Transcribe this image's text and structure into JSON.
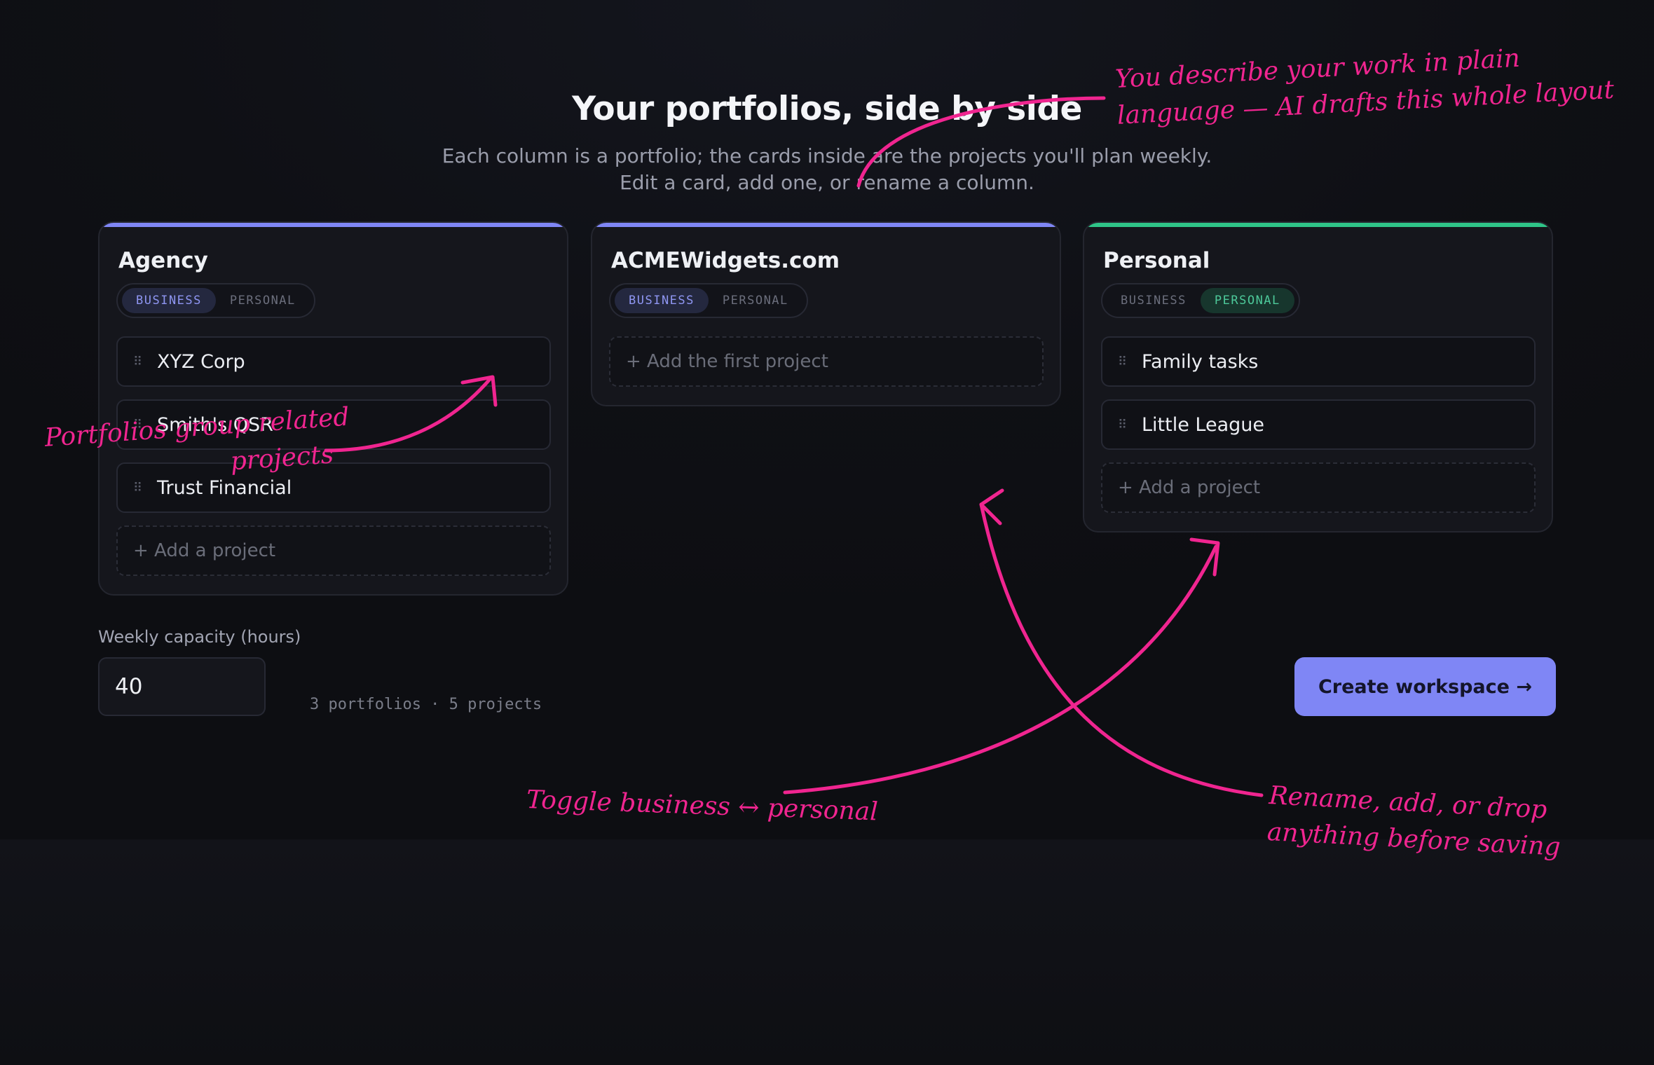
{
  "header": {
    "title": "Your portfolios, side by side",
    "subtitle": "Each column is a portfolio; the cards inside are the projects you'll plan weekly. Edit a card, add one, or rename a column."
  },
  "toggle_labels": {
    "business": "BUSINESS",
    "personal": "PERSONAL"
  },
  "portfolios": [
    {
      "name": "Agency",
      "mode": "business",
      "accent": "#7f86f5",
      "projects": [
        "XYZ Corp",
        "Smith's QSR",
        "Trust Financial"
      ],
      "add_label": "+ Add a project"
    },
    {
      "name": "ACMEWidgets.com",
      "mode": "business",
      "accent": "#7f86f5",
      "projects": [],
      "add_label": "+ Add the first project"
    },
    {
      "name": "Personal",
      "mode": "personal",
      "accent": "#2fc488",
      "projects": [
        "Family tasks",
        "Little League"
      ],
      "add_label": "+ Add a project"
    }
  ],
  "capacity": {
    "label": "Weekly capacity (hours)",
    "value": "40"
  },
  "summary": "3 portfolios · 5 projects",
  "create_button": "Create workspace →",
  "annotations": {
    "top_right": [
      "You describe your work in plain",
      "language — AI drafts this whole layout"
    ],
    "left": [
      "Portfolios group related",
      "projects"
    ],
    "toggle": "Toggle business ↔ personal",
    "rename": [
      "Rename, add, or drop",
      "anything before saving"
    ]
  },
  "colors": {
    "annotation": "#f02590",
    "primary_button": "#7f86f5",
    "personal_accent": "#2fc488"
  }
}
